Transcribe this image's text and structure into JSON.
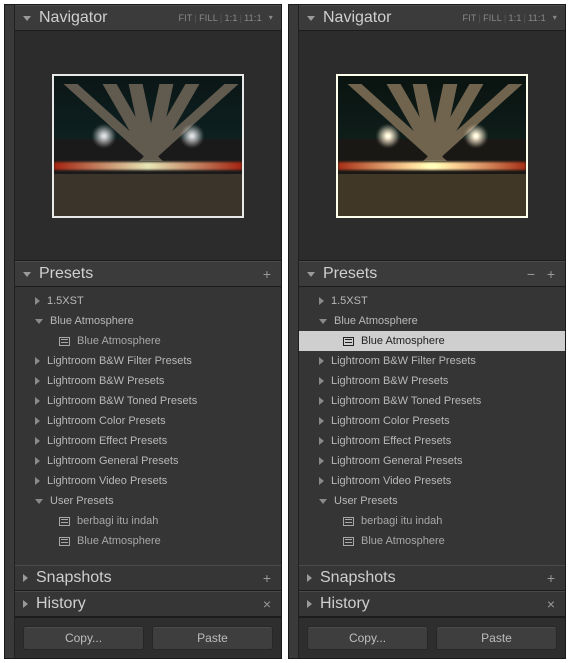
{
  "panels": [
    {
      "navigator": {
        "title": "Navigator",
        "zoom": [
          "FIT",
          "FILL",
          "1:1",
          "11:1"
        ]
      },
      "presets": {
        "title": "Presets",
        "showMinus": false,
        "highlightIndex": -1,
        "nodes": [
          {
            "type": "folder",
            "state": "closed",
            "label": "1.5XST"
          },
          {
            "type": "folder",
            "state": "open",
            "label": "Blue Atmosphere"
          },
          {
            "type": "preset",
            "label": "Blue Atmosphere"
          },
          {
            "type": "folder",
            "state": "closed",
            "label": "Lightroom B&W Filter Presets"
          },
          {
            "type": "folder",
            "state": "closed",
            "label": "Lightroom B&W Presets"
          },
          {
            "type": "folder",
            "state": "closed",
            "label": "Lightroom B&W Toned Presets"
          },
          {
            "type": "folder",
            "state": "closed",
            "label": "Lightroom Color Presets"
          },
          {
            "type": "folder",
            "state": "closed",
            "label": "Lightroom Effect Presets"
          },
          {
            "type": "folder",
            "state": "closed",
            "label": "Lightroom General Presets"
          },
          {
            "type": "folder",
            "state": "closed",
            "label": "Lightroom Video Presets"
          },
          {
            "type": "folder",
            "state": "open",
            "label": "User Presets"
          },
          {
            "type": "preset",
            "label": "berbagi itu indah"
          },
          {
            "type": "preset",
            "label": "Blue Atmosphere"
          }
        ]
      },
      "snapshots": {
        "title": "Snapshots"
      },
      "history": {
        "title": "History"
      },
      "buttons": {
        "copy": "Copy...",
        "paste": "Paste"
      },
      "thumbWarm": false
    },
    {
      "navigator": {
        "title": "Navigator",
        "zoom": [
          "FIT",
          "FILL",
          "1:1",
          "11:1"
        ]
      },
      "presets": {
        "title": "Presets",
        "showMinus": true,
        "highlightIndex": 2,
        "nodes": [
          {
            "type": "folder",
            "state": "closed",
            "label": "1.5XST"
          },
          {
            "type": "folder",
            "state": "open",
            "label": "Blue Atmosphere"
          },
          {
            "type": "preset",
            "label": "Blue Atmosphere"
          },
          {
            "type": "folder",
            "state": "closed",
            "label": "Lightroom B&W Filter Presets"
          },
          {
            "type": "folder",
            "state": "closed",
            "label": "Lightroom B&W Presets"
          },
          {
            "type": "folder",
            "state": "closed",
            "label": "Lightroom B&W Toned Presets"
          },
          {
            "type": "folder",
            "state": "closed",
            "label": "Lightroom Color Presets"
          },
          {
            "type": "folder",
            "state": "closed",
            "label": "Lightroom Effect Presets"
          },
          {
            "type": "folder",
            "state": "closed",
            "label": "Lightroom General Presets"
          },
          {
            "type": "folder",
            "state": "closed",
            "label": "Lightroom Video Presets"
          },
          {
            "type": "folder",
            "state": "open",
            "label": "User Presets"
          },
          {
            "type": "preset",
            "label": "berbagi itu indah"
          },
          {
            "type": "preset",
            "label": "Blue Atmosphere"
          }
        ]
      },
      "snapshots": {
        "title": "Snapshots"
      },
      "history": {
        "title": "History"
      },
      "buttons": {
        "copy": "Copy...",
        "paste": "Paste"
      },
      "thumbWarm": true
    }
  ]
}
